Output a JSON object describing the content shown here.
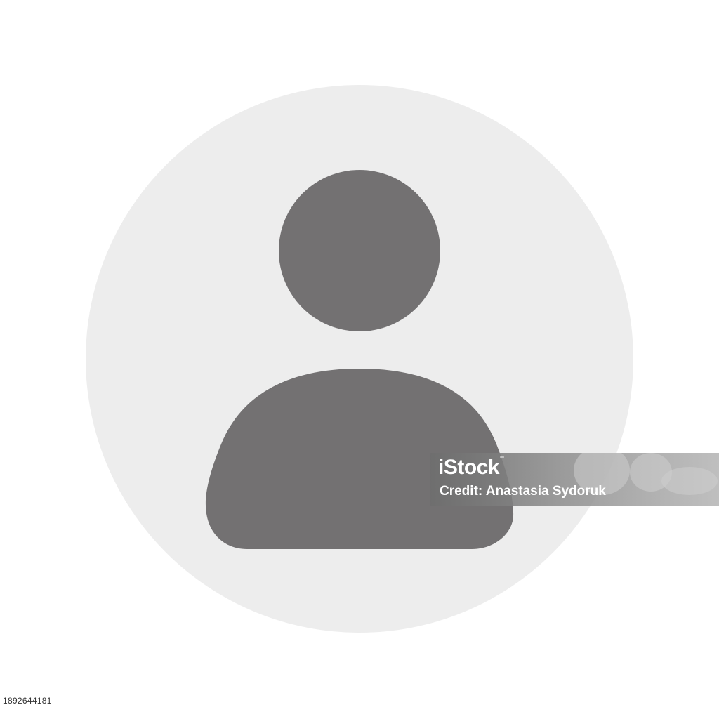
{
  "avatar": {
    "icon": "user-profile-icon",
    "background_color": "#ededed",
    "figure_color": "#737172"
  },
  "watermark": {
    "logo_text": "iStock",
    "trademark": "™",
    "credit_text": "Credit: Anastasia Sydoruk"
  },
  "footer": {
    "image_number": "1892644181"
  }
}
